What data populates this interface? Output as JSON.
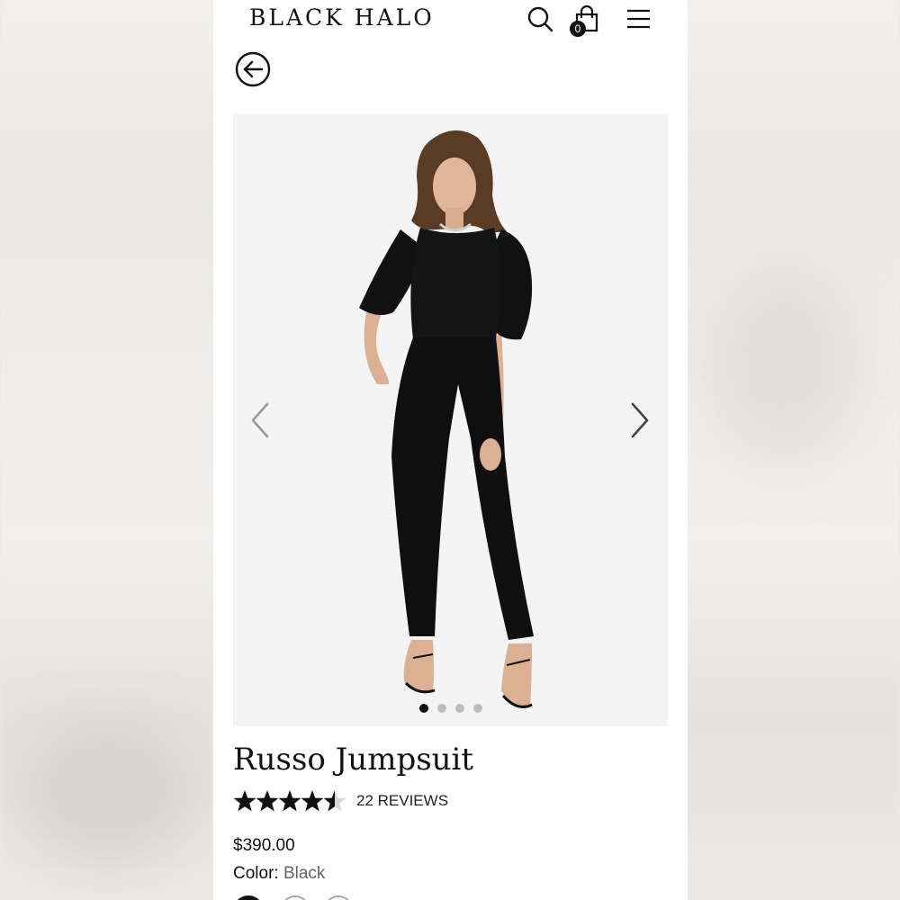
{
  "header": {
    "logo": "BLACK HALO",
    "cart_count": "0"
  },
  "icons": {
    "search": "search-icon",
    "bag": "shopping-bag-icon",
    "menu": "hamburger-menu-icon",
    "back": "back-arrow-icon",
    "prev": "chevron-left-icon",
    "next": "chevron-right-icon"
  },
  "gallery": {
    "image_count": 4,
    "active_index": 0
  },
  "product": {
    "name": "Russo Jumpsuit",
    "rating": 4.5,
    "rating_max": 5,
    "reviews_label": "22 REVIEWS",
    "price": "$390.00",
    "color_label": "Color:",
    "color_value": "Black"
  },
  "colors": {
    "accent": "#111111",
    "background": "#ffffff",
    "gallery_bg": "#f4f4f4",
    "muted_text": "#666666"
  }
}
